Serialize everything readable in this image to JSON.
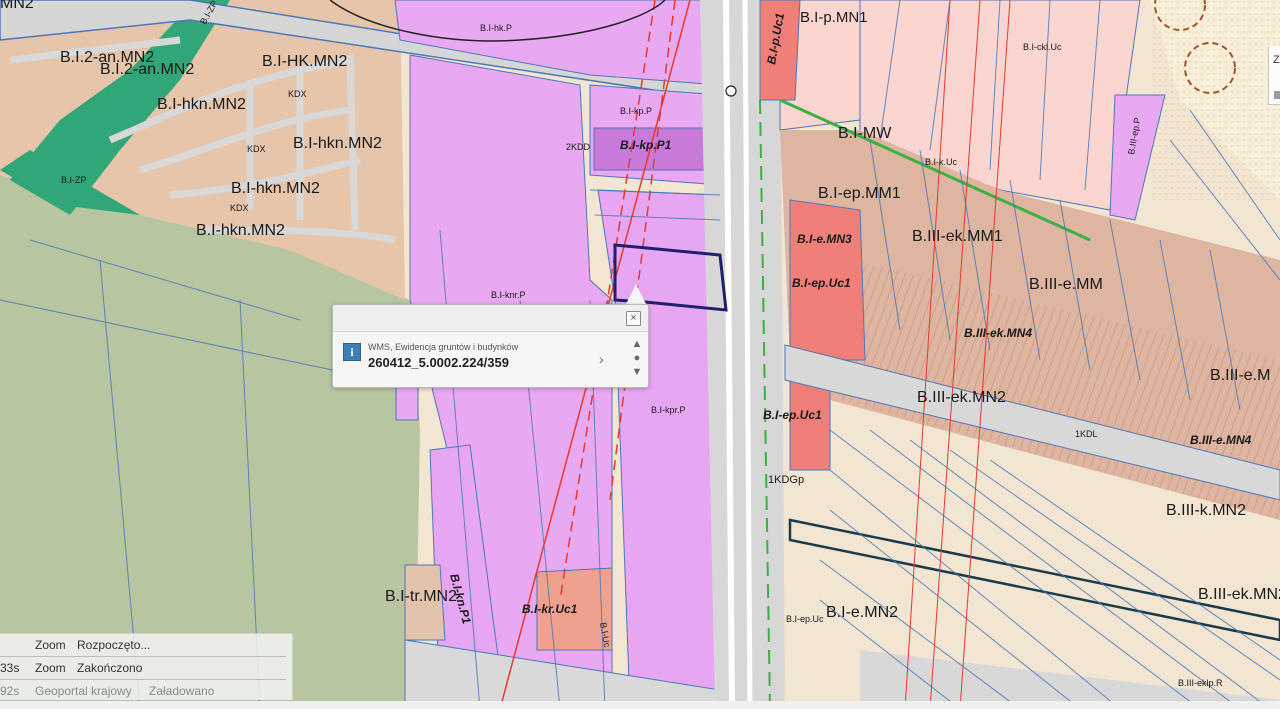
{
  "map": {
    "labels": {
      "l1": "B.I.2-an.MN2",
      "l2": "B.I.2-an.MN2",
      "l3": "B.I-HK.MN2",
      "l4": "B.I-hkn.MN2",
      "l5": "B.I-hkn.MN2",
      "l6": "B.I-hkn.MN2",
      "l7": "B.I-hkn.MN2",
      "l8": "B.I-ZP",
      "l9": "B.I-ZP",
      "l10": "B.I-hk.P",
      "l11": "B.I-kp.P",
      "l12": "B.I-kp.P1",
      "l13": "2KDD",
      "l14": "B.I-knr.P",
      "l15": "B.I-kpr.P",
      "l16": "B.I-kr.Uc1",
      "l17": "B.I-tr.MN2",
      "l18": "B.I-kn.P1",
      "l19": "B.I-Uc",
      "l20": "B.I-p.Uc1",
      "l21": "B.I-p.MN1",
      "l22": "B.I-ckl.Uc",
      "l23": "B.I-MW",
      "l24": "B.I-k.Uc",
      "l25": "B.I-ep.MM1",
      "l26": "B.I-e.MN3",
      "l27": "B.III-ek.MM1",
      "l28": "B.I-ep.Uc1",
      "l29": "B.III-e.MM",
      "l30": "B.III-ek.MN4",
      "l31": "B.III-ek.MN2",
      "l32": "B.I-ep.Uc1",
      "l33": "1KDGp",
      "l34": "B.III-e.MN4",
      "l35": "B.III-e.M",
      "l36": "B.III-k.MN2",
      "l37": "B.III-ek.MN2",
      "l38": "B.I-e.MN2",
      "l39": "B.I-ep.Uc",
      "l40": "B.III-eklp.R",
      "l41": "B.III-ep.P",
      "l42": "MN2",
      "l43": "1KDL",
      "l44": "KDX",
      "l45": "KDX",
      "l46": "KDX"
    },
    "colors": {
      "residential": "#e9c7ad",
      "residential_dark": "#cf9f86",
      "commercial": "#f07f7a",
      "industrial": "#e8a8f3",
      "green": "#2fa77a",
      "forest": "#b7c7a2",
      "road": "#dcdcdc",
      "parcel_line": "#4a78b8",
      "parcel_highlight": "#1f1f6e",
      "rail": "#e63a2c"
    }
  },
  "popup": {
    "source": "WMS, Ewidencja gruntów i budynków",
    "value": "260412_5.0002.224/359",
    "close_icon": "×",
    "info_icon": "i",
    "next_icon": "›",
    "nav_up": "▲",
    "nav_mid": "●",
    "nav_down": "▼"
  },
  "log": {
    "rows": [
      {
        "time": "",
        "source": "Zoom",
        "message": "Rozpoczęto..."
      },
      {
        "time": "33s",
        "source": "Zoom",
        "message": "Zakończono"
      },
      {
        "time": "92s",
        "source": "Geoportal krajowy",
        "message": "Załadowano"
      }
    ]
  },
  "scale": {
    "label": "Z"
  }
}
